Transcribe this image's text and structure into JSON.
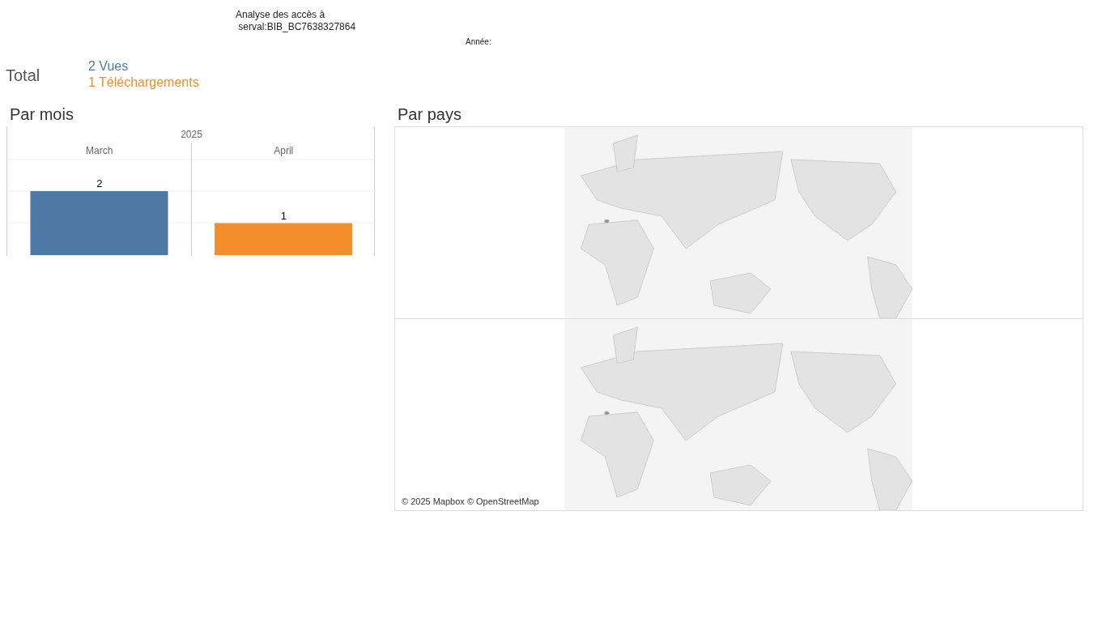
{
  "header": {
    "title": "Analyse des accès à",
    "subtitle": " serval:BIB_BC7638327864",
    "year_filter_label": "Année:"
  },
  "total": {
    "label": "Total",
    "items": [
      {
        "text": "2 Vues",
        "color": "#4e79a7"
      },
      {
        "text": "1 Téléchargements",
        "color": "#f28e2b"
      }
    ]
  },
  "by_month": {
    "title": "Par mois",
    "year_header": "2025",
    "chart_data": {
      "type": "bar",
      "categories": [
        "March",
        "April"
      ],
      "data_labels": true,
      "series": [
        {
          "color": "#4e79a7",
          "values": [
            2,
            null
          ]
        },
        {
          "color": "#f28e2b",
          "values": [
            null,
            1
          ]
        }
      ]
    }
  },
  "by_country": {
    "title": "Par pays",
    "attribution": "© 2025 Mapbox © OpenStreetMap"
  }
}
